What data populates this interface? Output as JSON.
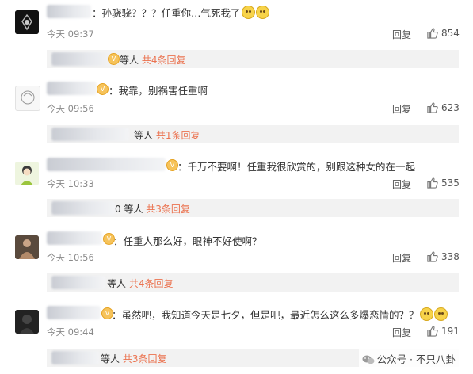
{
  "comments": [
    {
      "text": "：孙骁骁？？？任重你…气死我了",
      "time": "今天 09:37",
      "reply_label": "回复",
      "likes": "854",
      "thread": {
        "prefix": "等人",
        "link": "共4条回复"
      }
    },
    {
      "text": "：我靠，别祸害任重啊",
      "time": "今天 09:56",
      "reply_label": "回复",
      "likes": "623",
      "thread": {
        "prefix": "等人",
        "link": "共1条回复"
      }
    },
    {
      "text": "：千万不要啊！任重我很欣赏的，别跟这种女的在一起",
      "time": "今天 10:33",
      "reply_label": "回复",
      "likes": "535",
      "thread": {
        "prefix": "0 等人",
        "link": "共3条回复"
      }
    },
    {
      "text": "：任重人那么好，眼神不好使啊？",
      "time": "今天 10:56",
      "reply_label": "回复",
      "likes": "338",
      "thread": {
        "prefix": "等人",
        "link": "共4条回复"
      }
    },
    {
      "text": "：虽然吧，我知道今天是七夕，但是吧，最近怎么这么多爆恋情的？？",
      "time": "今天 09:44",
      "reply_label": "回复",
      "likes": "191",
      "thread": {
        "prefix": "等人",
        "link": "共3条回复"
      }
    }
  ],
  "watermark": {
    "text": "公众号 · 不只八卦"
  },
  "colors": {
    "link": "#eb7350",
    "subbox_bg": "#f2f2f2",
    "time": "#8a8a8a"
  },
  "icons": [
    "avatar",
    "vip-crown-icon",
    "emoji-icon",
    "thumbs-up-icon",
    "wechat-icon"
  ]
}
